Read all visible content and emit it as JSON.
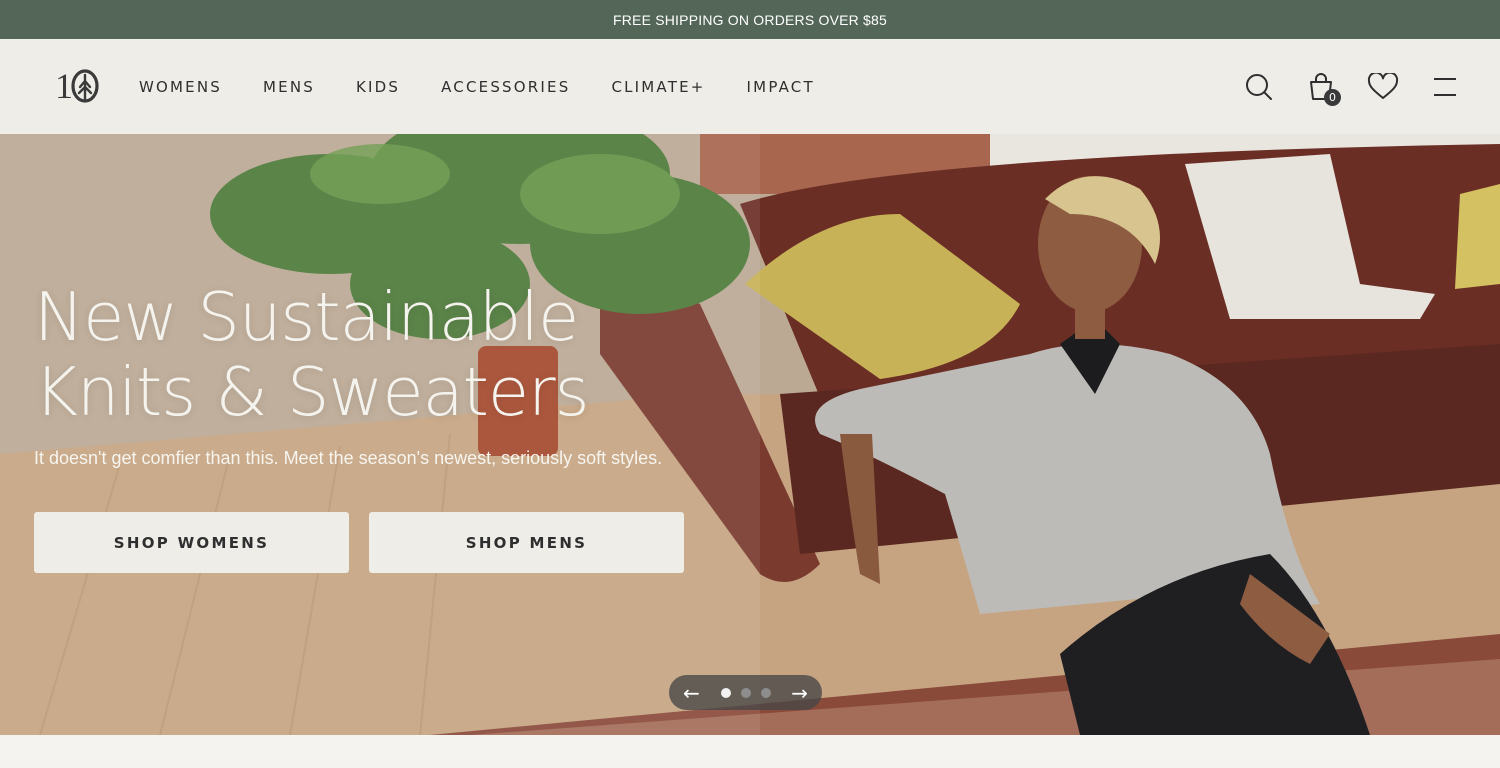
{
  "announcement": {
    "text": "FREE SHIPPING ON ORDERS OVER $85"
  },
  "header": {
    "logo_text": "1",
    "nav": [
      {
        "label": "WOMENS"
      },
      {
        "label": "MENS"
      },
      {
        "label": "KIDS"
      },
      {
        "label": "ACCESSORIES"
      },
      {
        "label": "CLIMATE+"
      },
      {
        "label": "IMPACT"
      }
    ],
    "icons": [
      "search-icon",
      "cart-icon",
      "heart-icon",
      "menu-icon"
    ],
    "cart_count": "0"
  },
  "hero": {
    "title_line1": "New Sustainable",
    "title_line2": "Knits & Sweaters",
    "subtitle": "It doesn't get comfier than this. Meet the season's newest, seriously soft styles.",
    "buttons": [
      {
        "label": "SHOP WOMENS"
      },
      {
        "label": "SHOP MENS"
      }
    ],
    "carousel": {
      "slides": 3,
      "active": 1,
      "prev_icon": "←",
      "next_icon": "→"
    }
  },
  "colors": {
    "announcement_bg": "#536658",
    "header_bg": "#eeede8",
    "button_bg": "#eeede8"
  }
}
